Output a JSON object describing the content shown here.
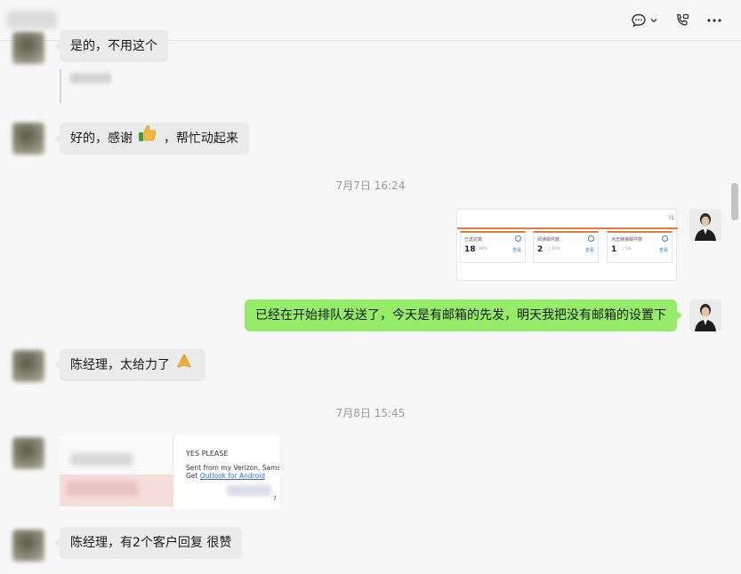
{
  "header": {
    "icons": [
      "chat-bubble-icon",
      "chevron-down-icon",
      "video-call-icon",
      "more-icon"
    ]
  },
  "messages": {
    "m1": {
      "text": "是的，不用这个"
    },
    "m2": {
      "text_before": "好的，感谢",
      "text_after": "，帮忙动起来"
    },
    "ts1": "7月7日 16:24",
    "m3_card": {
      "q": "?1",
      "boxes": [
        {
          "label": "已送达数",
          "num": "18",
          "pct": "| 90%",
          "link": "查看"
        },
        {
          "label": "阅读邮件数",
          "num": "2",
          "pct": "| 10%",
          "link": "查看"
        },
        {
          "label": "点击链接邮件数",
          "num": "1",
          "pct": "| 5%",
          "link": "查看"
        }
      ]
    },
    "m4": {
      "text": "已经在开始排队发送了，今天是有邮箱的先发，明天我把没有邮箱的设置下"
    },
    "m5": {
      "text": "陈经理，太给力了"
    },
    "ts2": "7月8日 15:45",
    "m6_card": {
      "yes": "YES PLEASE",
      "sent": "Sent from my Verizon, Samsung",
      "get_prefix": "Get ",
      "get_link": "Outlook for Android",
      "seven": "7"
    },
    "m7": {
      "text": "陈经理，有2个客户回复 很赞"
    }
  },
  "colors": {
    "bubble_out": "#95ec69",
    "bubble_in": "#ebebeb",
    "accent_orange": "#e57a3a",
    "link_blue": "#2b6cd6"
  }
}
